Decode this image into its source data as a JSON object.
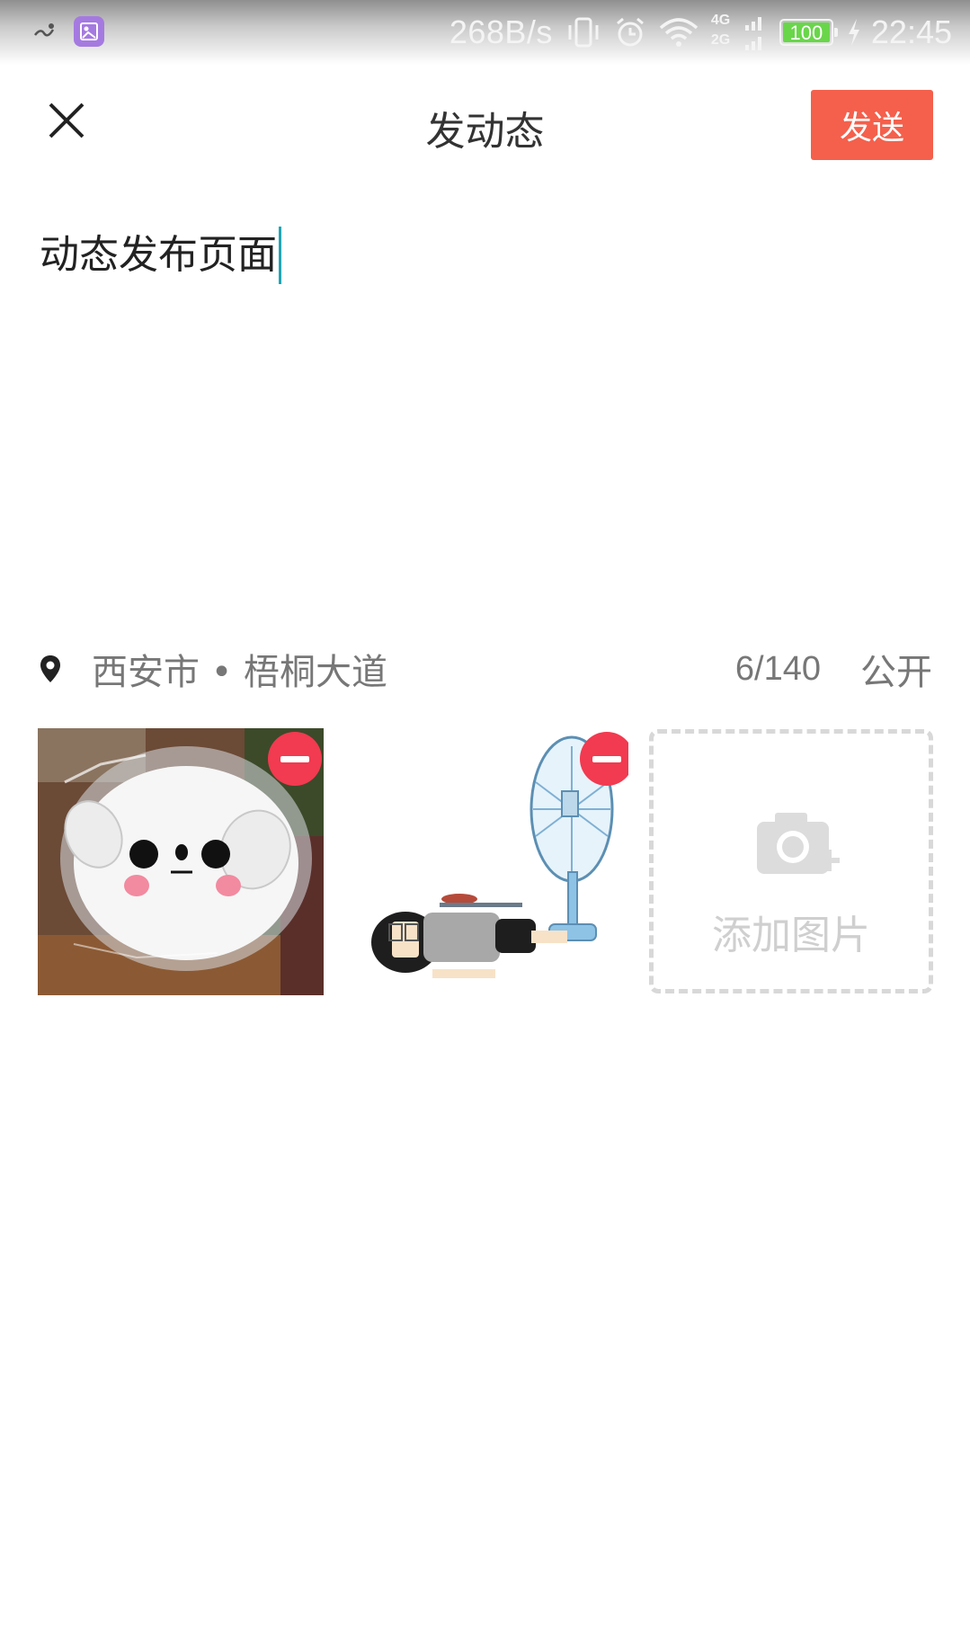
{
  "status_bar": {
    "speed": "268B/s",
    "network_top": "4G",
    "network_bottom": "2G",
    "battery": "100",
    "time": "22:45"
  },
  "header": {
    "title": "发动态",
    "send_label": "发送"
  },
  "post": {
    "text": "动态发布页面"
  },
  "meta": {
    "location": "西安市 • 梧桐大道",
    "counter": "6/140",
    "privacy": "公开"
  },
  "images": {
    "add_label": "添加图片"
  },
  "colors": {
    "send_button": "#f4604c",
    "remove_button": "#f23a50",
    "caret": "#1fa7b5",
    "battery_fill": "#69d64a"
  }
}
